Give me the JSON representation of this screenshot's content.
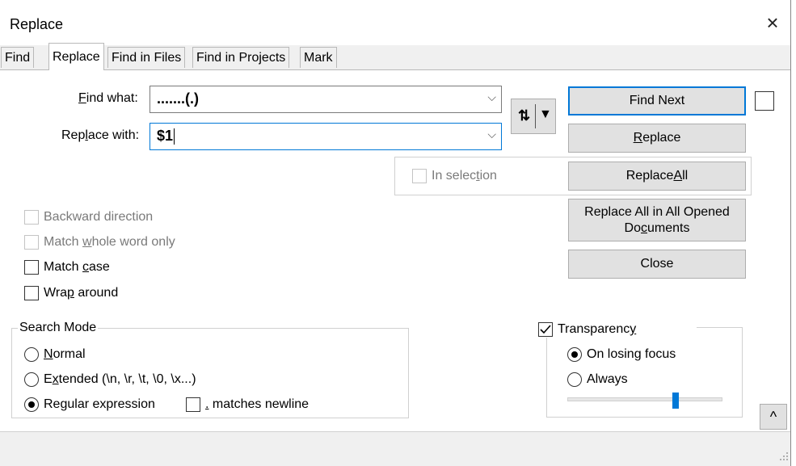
{
  "window": {
    "title": "Replace",
    "close_glyph": "×"
  },
  "tabs": [
    {
      "label": "Find",
      "active": false
    },
    {
      "label": "Replace",
      "active": true
    },
    {
      "label": "Find in Files",
      "active": false
    },
    {
      "label": "Find in Projects",
      "active": false
    },
    {
      "label": "Mark",
      "active": false
    }
  ],
  "find": {
    "label_pre": "",
    "label_key": "F",
    "label_post": "ind what:",
    "value": ".......(.)",
    "dropdown_glyph": "⌵"
  },
  "replace": {
    "label_pre": "Rep",
    "label_key": "l",
    "label_post": "ace with:",
    "value": "$1",
    "dropdown_glyph": "⌵"
  },
  "swap": {
    "glyph": "⇅",
    "arrow": "▼"
  },
  "buttons": {
    "find_next": "Find Next",
    "replace_pre": "",
    "replace_key": "R",
    "replace_post": "eplace",
    "replace_all_pre": "Replace ",
    "replace_all_key": "A",
    "replace_all_post": "ll",
    "replace_all_opened_line1": "Replace All in All Opened",
    "replace_all_opened_line2_pre": "Do",
    "replace_all_opened_line2_key": "c",
    "replace_all_opened_line2_post": "uments",
    "close": "Close",
    "scroll_up": "^"
  },
  "in_selection": {
    "pre": "In selec",
    "key": "t",
    "post": "ion",
    "checked": false
  },
  "options": {
    "backward": {
      "label": "Backward direction",
      "checked": false,
      "enabled": false
    },
    "whole_word": {
      "pre": "Match ",
      "key": "w",
      "post": "hole word only",
      "checked": false,
      "enabled": false
    },
    "match_case": {
      "pre": "Match ",
      "key": "c",
      "post": "ase",
      "checked": false,
      "enabled": true
    },
    "wrap": {
      "pre": "Wra",
      "key": "p",
      "post": " around",
      "checked": false,
      "enabled": true
    }
  },
  "search_mode": {
    "title": "Search Mode",
    "normal": {
      "pre": "",
      "key": "N",
      "post": "ormal",
      "selected": false
    },
    "extended": {
      "pre": "E",
      "key": "x",
      "post": "tended (\\n, \\r, \\t, \\0, \\x...)",
      "selected": false
    },
    "regex": {
      "pre": "Re",
      "key": "g",
      "post": "ular expression",
      "selected": true
    },
    "matches_newline": {
      "key": ".",
      "post": " matches newline",
      "checked": false
    }
  },
  "transparency": {
    "pre": "Transparenc",
    "key": "y",
    "post": "",
    "checked": true,
    "on_losing_focus": {
      "label": "On losing focus",
      "selected": true
    },
    "always": {
      "label": "Always",
      "selected": false
    },
    "slider_value": 0.7
  },
  "colors": {
    "accent": "#0078d7",
    "slider_thumb": "#0078d7"
  }
}
